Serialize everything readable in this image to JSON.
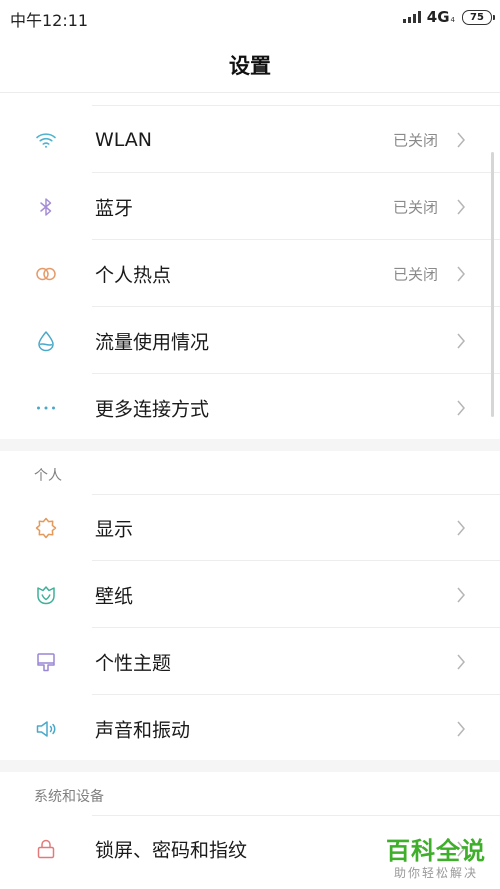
{
  "status_bar": {
    "time": "中午12:11",
    "network": "4G",
    "network_sub": "4",
    "battery": "75"
  },
  "header": {
    "title": "设置"
  },
  "connectivity": {
    "items": [
      {
        "icon": "wifi-icon",
        "label": "WLAN",
        "value": "已关闭"
      },
      {
        "icon": "bluetooth-icon",
        "label": "蓝牙",
        "value": "已关闭"
      },
      {
        "icon": "hotspot-icon",
        "label": "个人热点",
        "value": "已关闭"
      },
      {
        "icon": "data-usage-icon",
        "label": "流量使用情况",
        "value": ""
      },
      {
        "icon": "more-icon",
        "label": "更多连接方式",
        "value": ""
      }
    ]
  },
  "personal": {
    "title": "个人",
    "items": [
      {
        "icon": "display-icon",
        "label": "显示"
      },
      {
        "icon": "wallpaper-icon",
        "label": "壁纸"
      },
      {
        "icon": "theme-icon",
        "label": "个性主题"
      },
      {
        "icon": "sound-icon",
        "label": "声音和振动"
      }
    ]
  },
  "system": {
    "title": "系统和设备",
    "items": [
      {
        "icon": "lock-icon",
        "label": "锁屏、密码和指纹"
      }
    ]
  },
  "watermark": {
    "main": "百科全说",
    "sub": "助你轻松解决"
  },
  "colors": {
    "wifi": "#4fb3cf",
    "bluetooth": "#a58ed6",
    "hotspot": "#e59a6a",
    "data_usage": "#4aa8c9",
    "more": "#4aa8c9",
    "display": "#e39a5b",
    "wallpaper": "#3fb09a",
    "theme": "#9a86d6",
    "sound": "#4aa8c9",
    "lock": "#e37a7a",
    "watermark": "#3fae2a"
  }
}
